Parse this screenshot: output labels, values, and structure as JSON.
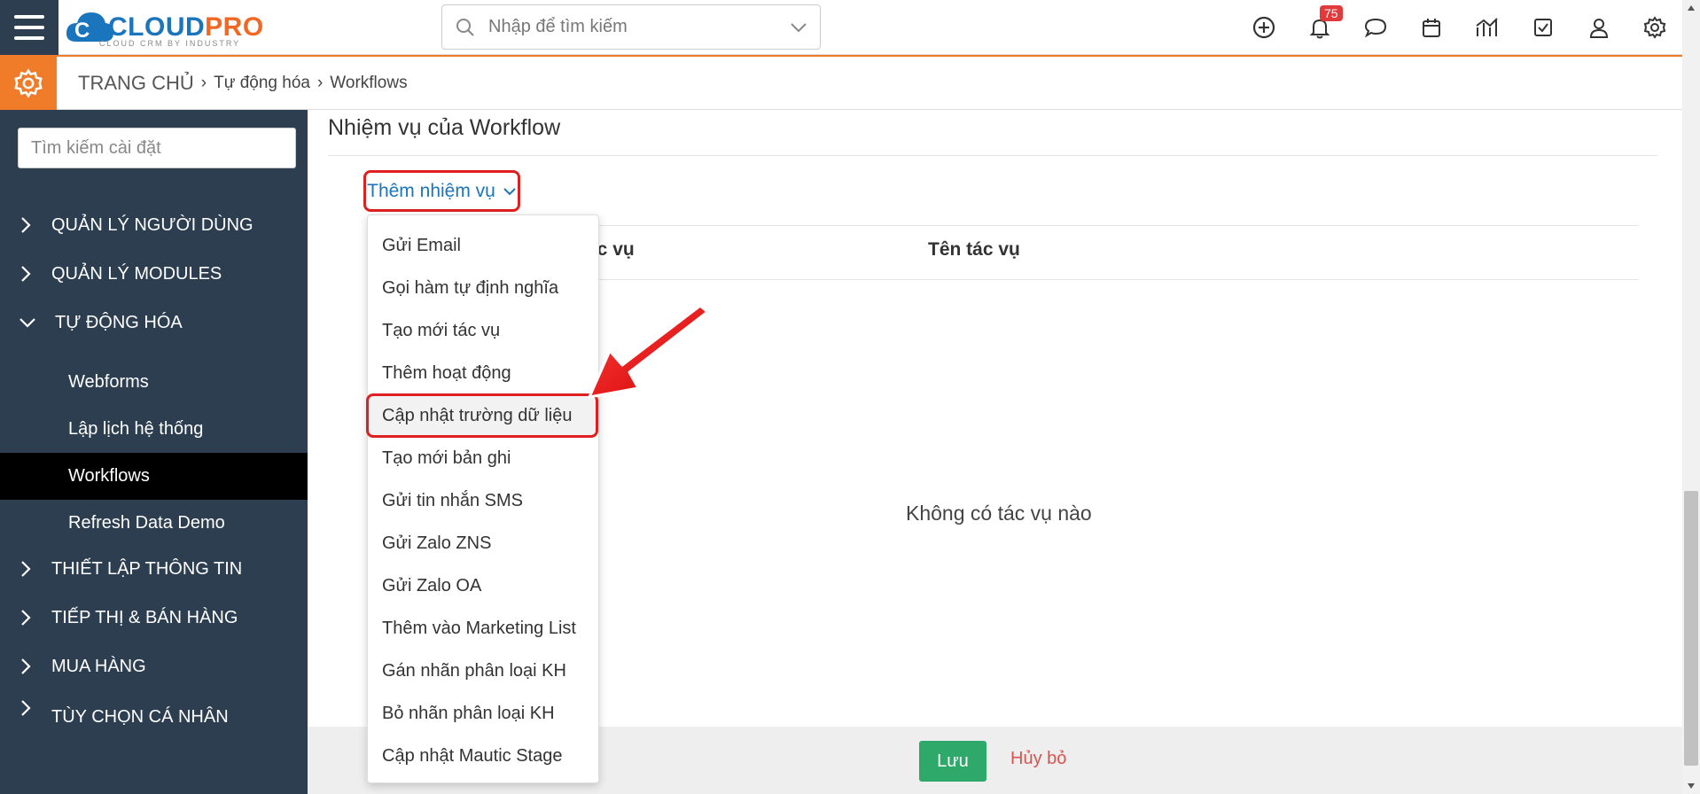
{
  "header": {
    "logo_main_a": "CLOUD",
    "logo_main_b": "PRO",
    "logo_sub": "CLOUD CRM BY INDUSTRY",
    "search_placeholder": "Nhập để tìm kiếm",
    "notification_count": "75",
    "icons": [
      "plus-circle-icon",
      "bell-icon",
      "chat-icon",
      "calendar-icon",
      "chart-icon",
      "checkbox-icon",
      "user-icon",
      "gear-icon"
    ]
  },
  "breadcrumb": {
    "home": "TRANG CHỦ",
    "level1": "Tự động hóa",
    "level2": "Workflows"
  },
  "sidebar": {
    "search_placeholder": "Tìm kiếm cài đặt",
    "groups": [
      {
        "label": "QUẢN LÝ NGƯỜI DÙNG",
        "expanded": false
      },
      {
        "label": "QUẢN LÝ MODULES",
        "expanded": false
      },
      {
        "label": "TỰ ĐỘNG HÓA",
        "expanded": true
      },
      {
        "label": "THIẾT LẬP THÔNG TIN",
        "expanded": false
      },
      {
        "label": "TIẾP THỊ & BÁN HÀNG",
        "expanded": false
      },
      {
        "label": "MUA HÀNG",
        "expanded": false
      },
      {
        "label": "TÙY CHỌN CÁ NHÂN",
        "expanded": false
      }
    ],
    "sub_items": [
      "Webforms",
      "Lập lịch hệ thống",
      "Workflows",
      "Refresh Data Demo"
    ],
    "active_sub": "Workflows"
  },
  "main": {
    "section_title": "Nhiệm vụ của Workflow",
    "add_button": "Thêm nhiệm vụ",
    "col_partial": "ác vụ",
    "col_task_name": "Tên tác vụ",
    "empty_text": "Không có tác vụ nào"
  },
  "dropdown": {
    "items": [
      "Gửi Email",
      "Gọi hàm tự định nghĩa",
      "Tạo mới tác vụ",
      "Thêm hoạt động",
      "Cập nhật trường dữ liệu",
      "Tạo mới bản ghi",
      "Gửi tin nhắn SMS",
      "Gửi Zalo ZNS",
      "Gửi Zalo OA",
      "Thêm vào Marketing List",
      "Gán nhãn phân loại KH",
      "Bỏ nhãn phân loại KH",
      "Cập nhật Mautic Stage"
    ],
    "highlighted": "Cập nhật trường dữ liệu"
  },
  "footer": {
    "save": "Lưu",
    "cancel": "Hủy bỏ"
  },
  "colors": {
    "sidebar_bg": "#2c3e50",
    "accent_orange": "#f07c2a",
    "brand_blue": "#1b75bc",
    "save_green": "#2fa96a",
    "cancel_red": "#d9534f",
    "highlight_red": "#e02020"
  }
}
